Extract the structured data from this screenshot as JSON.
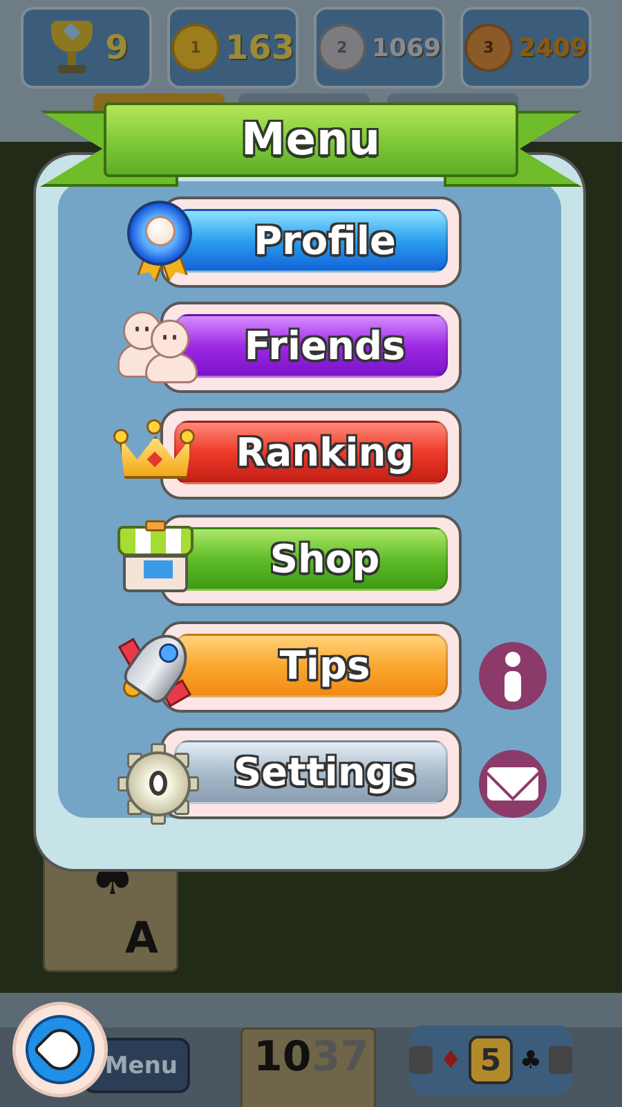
{
  "stats": {
    "trophies": "9",
    "gold": "163",
    "silver": "1069",
    "bronze": "2409",
    "gold_medal_number": "1",
    "silver_medal_number": "2",
    "bronze_medal_number": "3"
  },
  "menu": {
    "title": "Menu",
    "items": [
      {
        "label": "Profile",
        "icon": "rosette-icon"
      },
      {
        "label": "Friends",
        "icon": "friends-icon"
      },
      {
        "label": "Ranking",
        "icon": "crown-icon"
      },
      {
        "label": "Shop",
        "icon": "shop-icon"
      },
      {
        "label": "Tips",
        "icon": "rocket-icon"
      },
      {
        "label": "Settings",
        "icon": "gear-icon"
      }
    ],
    "side_buttons": {
      "info": "info-icon",
      "mail": "mail-icon"
    }
  },
  "background": {
    "card_rank": "A",
    "card_suit": "♠",
    "menu_button_label": "Menu",
    "deck_top": "10",
    "deck_count": "37",
    "level": "5"
  },
  "colors": {
    "ribbon": "#7cc838",
    "panel": "#c6e3e7",
    "panel_inner": "#75a5c6",
    "profile": "#2aa0ee",
    "friends": "#9e2ae4",
    "ranking": "#ee3a2a",
    "shop": "#5fbd2a",
    "tips": "#fba830",
    "settings": "#a9bccd",
    "side_button": "#8c3a6a"
  }
}
